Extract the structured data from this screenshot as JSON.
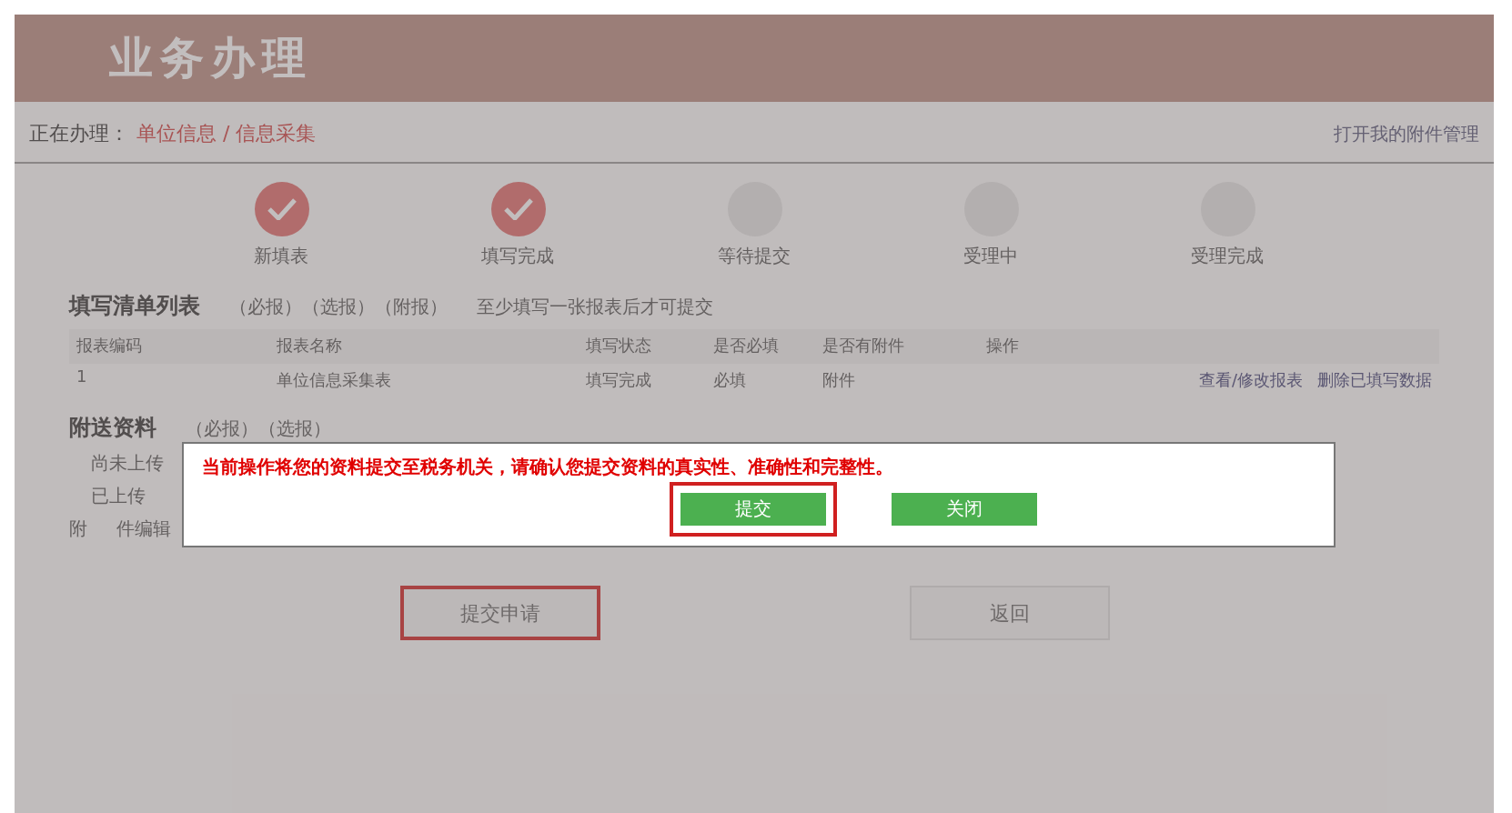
{
  "header": {
    "title": "业务办理"
  },
  "breadcrumb": {
    "label": "正在办理：",
    "path": "单位信息 / 信息采集",
    "link": "打开我的附件管理"
  },
  "steps": [
    {
      "label": "新填表",
      "done": true
    },
    {
      "label": "填写完成",
      "done": true
    },
    {
      "label": "等待提交",
      "done": false
    },
    {
      "label": "受理中",
      "done": false
    },
    {
      "label": "受理完成",
      "done": false
    }
  ],
  "form_list": {
    "title": "填写清单列表",
    "legend": "（必报）（选报）（附报）",
    "note": "至少填写一张报表后才可提交",
    "columns": [
      "报表编码",
      "报表名称",
      "填写状态",
      "是否必填",
      "是否有附件",
      "操作"
    ],
    "rows": [
      {
        "cells": [
          "1",
          "单位信息采集表",
          "填写完成",
          "必填",
          "附件"
        ],
        "actions": [
          "查看/修改报表",
          "删除已填写数据"
        ]
      }
    ]
  },
  "attachments": {
    "title": "附送资料",
    "legend": "（必报）（选报）",
    "items": [
      "尚未上传",
      "已上传"
    ],
    "row_label": "附",
    "row_value": "件编辑"
  },
  "actions": [
    {
      "label": "提交申请",
      "highlighted": true
    },
    {
      "label": "返回",
      "highlighted": false
    }
  ],
  "dialog": {
    "message": "当前操作将您的资料提交至税务机关，请确认您提交资料的真实性、准确性和完整性。",
    "buttons": [
      {
        "label": "提交",
        "highlighted": true
      },
      {
        "label": "关闭",
        "highlighted": false
      }
    ]
  }
}
